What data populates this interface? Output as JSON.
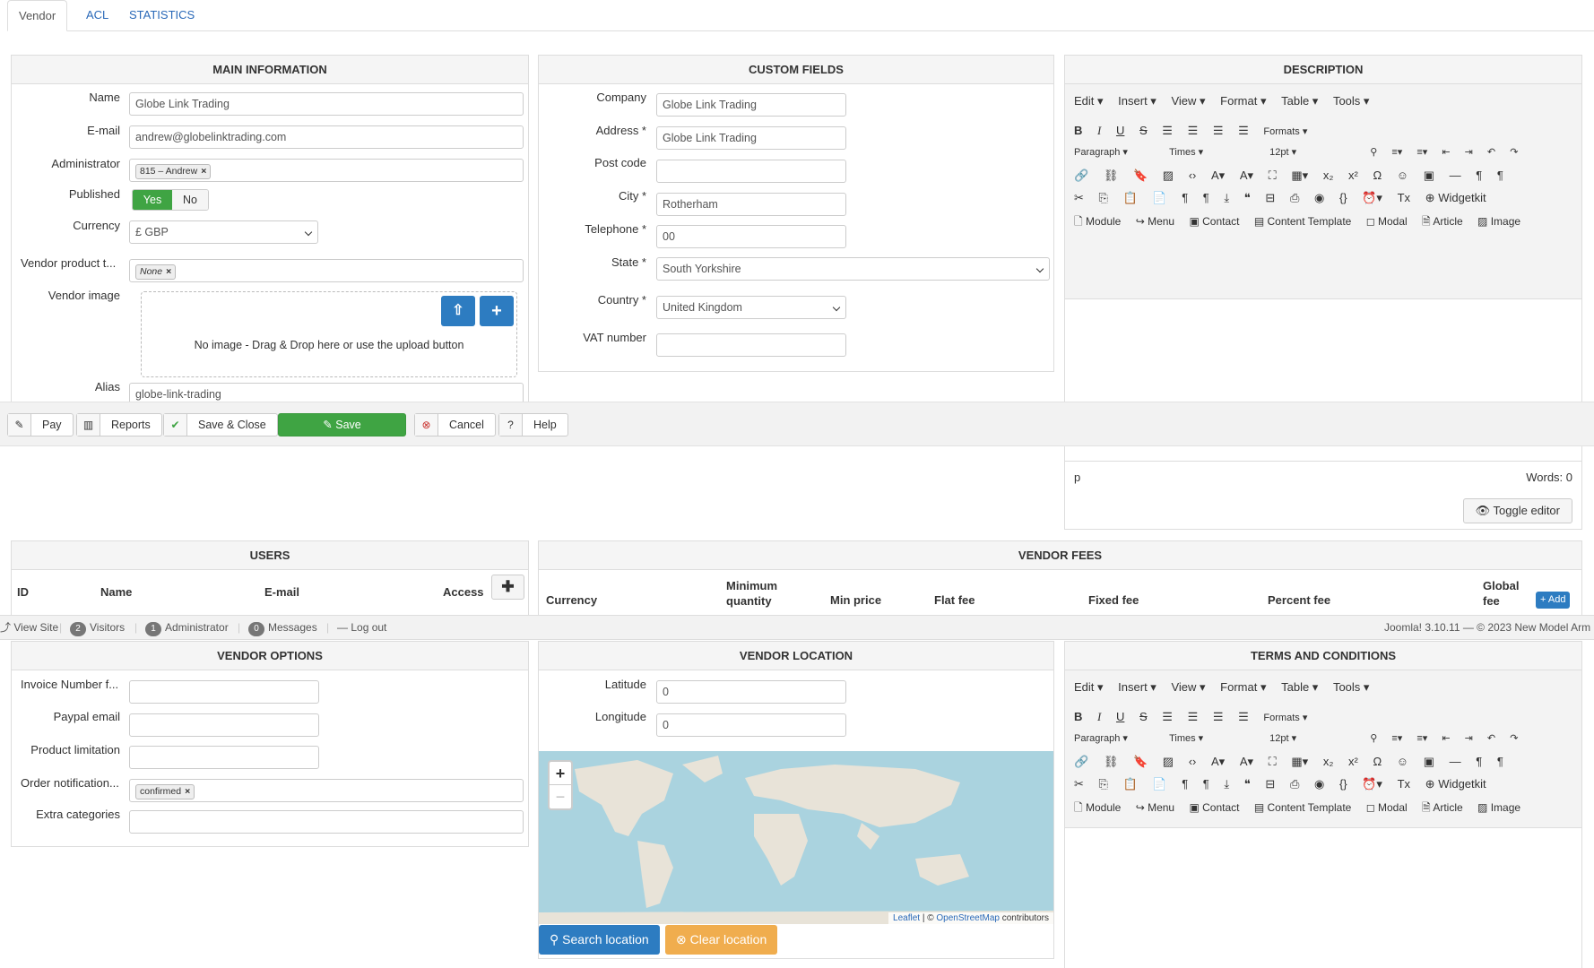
{
  "tabs": [
    {
      "label": "Vendor"
    },
    {
      "label": "ACL"
    },
    {
      "label": "STATISTICS"
    }
  ],
  "main_info": {
    "title": "MAIN INFORMATION",
    "name_label": "Name",
    "name_value": "Globe Link Trading",
    "email_label": "E-mail",
    "email_value": "andrew@globelinktrading.com",
    "admin_label": "Administrator",
    "admin_chip": "815 – Andrew",
    "published_label": "Published",
    "yes": "Yes",
    "no": "No",
    "currency_label": "Currency",
    "currency_value": "£ GBP",
    "ptype_label": "Vendor product t...",
    "ptype_chip": "None",
    "image_label": "Vendor image",
    "image_text": "No image - Drag & Drop here or use the upload button",
    "alias_label": "Alias",
    "alias_value": "globe-link-trading"
  },
  "custom": {
    "title": "CUSTOM FIELDS",
    "company_label": "Company",
    "company_value": "Globe Link Trading",
    "address_label": "Address *",
    "address_value": "Globe Link Trading",
    "postcode_label": "Post code",
    "postcode_value": "",
    "city_label": "City *",
    "city_value": "Rotherham",
    "tel_label": "Telephone *",
    "tel_value": "00",
    "state_label": "State *",
    "state_value": "South Yorkshire",
    "country_label": "Country *",
    "country_value": "United Kingdom",
    "vat_label": "VAT number",
    "vat_value": ""
  },
  "description": {
    "title": "DESCRIPTION",
    "menu": [
      "Edit",
      "Insert",
      "View",
      "Format",
      "Table",
      "Tools"
    ],
    "formats": "Formats",
    "paragraph": "Paragraph",
    "font": "Times",
    "size": "12pt",
    "widgetkit": "Widgetkit",
    "inserts": [
      "Module",
      "Menu",
      "Contact",
      "Content Template",
      "Modal",
      "Article",
      "Image"
    ],
    "path": "p",
    "words": "Words: 0",
    "toggle": "Toggle editor"
  },
  "toolbar": {
    "pay": "Pay",
    "reports": "Reports",
    "save_close": "Save & Close",
    "save": "Save",
    "cancel": "Cancel",
    "help": "Help"
  },
  "users": {
    "title": "USERS",
    "cols": [
      "ID",
      "Name",
      "E-mail",
      "Access"
    ]
  },
  "fees": {
    "title": "VENDOR FEES",
    "cols": [
      "Currency",
      "Minimum quantity",
      "Min price",
      "Flat fee",
      "Fixed fee",
      "Percent fee",
      "Global fee"
    ],
    "add": "Add"
  },
  "status": {
    "view_site": "View Site",
    "visitors_count": "2",
    "visitors": "Visitors",
    "admin_count": "1",
    "admin": "Administrator",
    "msg_count": "0",
    "messages": "Messages",
    "logout": "Log out",
    "version": "Joomla! 3.10.11  —  © 2023 New Model Arm"
  },
  "options": {
    "title": "VENDOR OPTIONS",
    "invoice_label": "Invoice Number f...",
    "paypal_label": "Paypal email",
    "limit_label": "Product limitation",
    "notif_label": "Order notification...",
    "notif_chip": "confirmed",
    "extra_label": "Extra categories"
  },
  "location": {
    "title": "VENDOR LOCATION",
    "lat_label": "Latitude",
    "lat_value": "0",
    "lon_label": "Longitude",
    "lon_value": "0",
    "zoom_in": "+",
    "zoom_out": "−",
    "leaflet": "Leaflet",
    "attr_mid": " | © ",
    "osm": "OpenStreetMap",
    "attr_end": " contributors",
    "search": "Search location",
    "clear": "Clear location"
  },
  "terms": {
    "title": "TERMS AND CONDITIONS"
  },
  "colors": {
    "accent": "#2d7cc1",
    "success": "#3fa443",
    "warning": "#f0ad4e",
    "danger": "#c9302c"
  }
}
